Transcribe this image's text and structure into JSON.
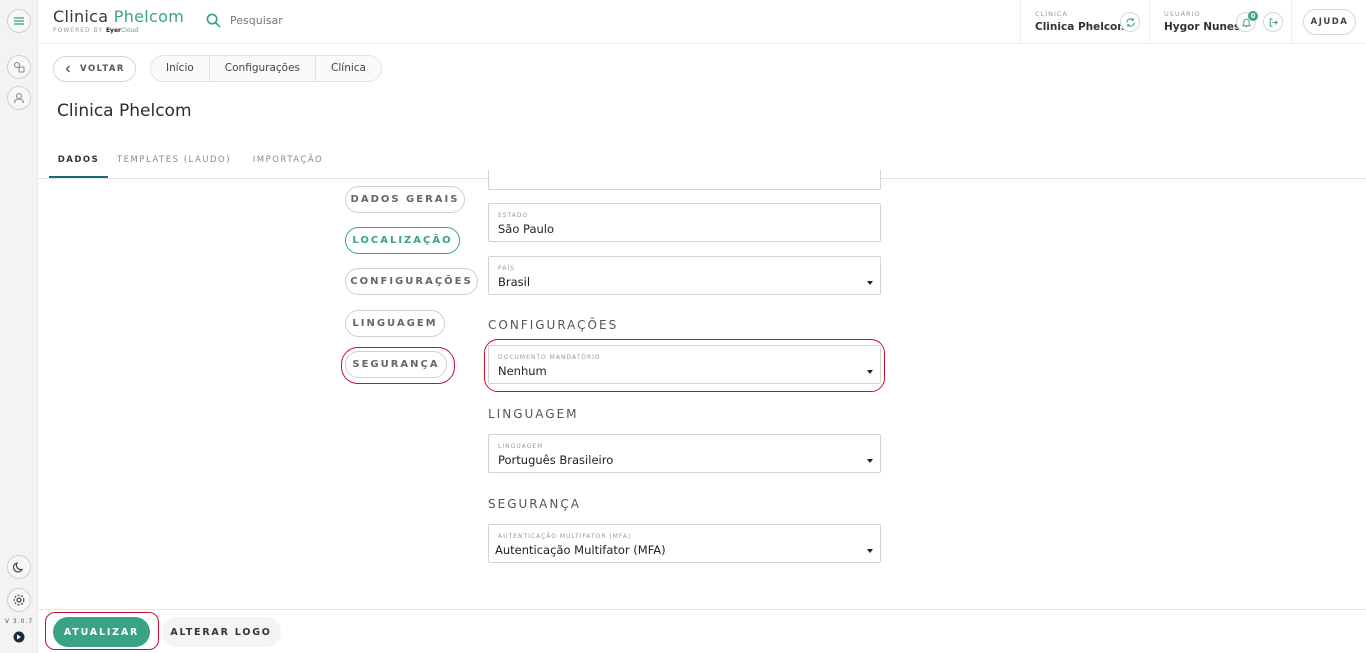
{
  "app": {
    "brand_main": "Clinica",
    "brand_accent": "Phelcom",
    "powered_by": "POWERED BY",
    "powered_eyer": "Eyer",
    "powered_cloud": "Cloud",
    "version": "V 3.0.7"
  },
  "search": {
    "placeholder": "Pesquisar"
  },
  "header": {
    "clinic_label": "CLÍNICA",
    "clinic_value": "Clinica Phelcom",
    "user_label": "USUÁRIO",
    "user_value": "Hygor Nunes",
    "notifications_count": "0",
    "help_label": "AJUDA"
  },
  "nav": {
    "back_label": "VOLTAR",
    "breadcrumbs": [
      "Início",
      "Configurações",
      "Clínica"
    ]
  },
  "page": {
    "title": "Clinica Phelcom"
  },
  "tabs": [
    "DADOS",
    "TEMPLATES (LAUDO)",
    "IMPORTAÇÃO"
  ],
  "sections": [
    "DADOS GERAIS",
    "LOCALIZAÇÃO",
    "CONFIGURAÇÕES",
    "LINGUAGEM",
    "SEGURANÇA"
  ],
  "form": {
    "estado": {
      "label": "ESTADO",
      "value": "São Paulo"
    },
    "pais": {
      "label": "PAÍS",
      "value": "Brasil"
    },
    "config_heading": "CONFIGURAÇÕES",
    "documento": {
      "label": "DOCUMENTO MANDATÓRIO",
      "value": "Nenhum"
    },
    "lang_heading": "LINGUAGEM",
    "linguagem": {
      "label": "LINGUAGEM",
      "value": "Português Brasileiro"
    },
    "sec_heading": "SEGURANÇA",
    "mfa": {
      "label": "AUTENTICAÇÃO MULTIFATOR (MFA)",
      "value": "Autenticação Multifator (MFA)"
    }
  },
  "footer": {
    "update_label": "ATUALIZAR",
    "change_logo_label": "ALTERAR LOGO"
  },
  "colors": {
    "accent": "#3aa386",
    "highlight": "#c8102e",
    "tab_underline": "#1f6a73"
  }
}
